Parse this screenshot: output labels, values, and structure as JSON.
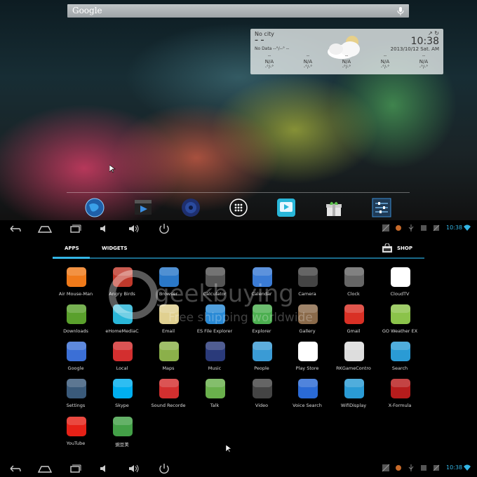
{
  "home": {
    "search": {
      "logo": "Google"
    },
    "weather": {
      "city": "No city",
      "dash": "– –",
      "nodata": "No Data --°/--° --",
      "time": "10:38",
      "date": "2013/10/12 Sat. AM",
      "columns": [
        {
          "top": "--",
          "value": "N/A",
          "bottom": "-°/-°"
        },
        {
          "top": "--",
          "value": "N/A",
          "bottom": "-°/-°"
        },
        {
          "top": "--",
          "value": "N/A",
          "bottom": "-°/-°"
        },
        {
          "top": "--",
          "value": "N/A",
          "bottom": "-°/-°"
        },
        {
          "top": "--",
          "value": "N/A",
          "bottom": "-°/-°"
        }
      ]
    },
    "dock": [
      "globe-icon",
      "video-player-icon",
      "speaker-icon",
      "all-apps-icon",
      "ehome-media-icon",
      "gift-box-icon",
      "settings-sliders-icon"
    ]
  },
  "statusbar": {
    "time": "10:38"
  },
  "drawer": {
    "tabs": {
      "apps": "APPS",
      "widgets": "WIDGETS",
      "shop": "SHOP"
    },
    "apps": [
      {
        "label": "Air Mouse-Man",
        "icon": "air-mouse-icon",
        "color": "#f07a1a"
      },
      {
        "label": "Angry Birds",
        "icon": "angry-birds-icon",
        "color": "#c0392b"
      },
      {
        "label": "Browser",
        "icon": "browser-globe-icon",
        "color": "#2a78c8"
      },
      {
        "label": "Calculator",
        "icon": "calculator-icon",
        "color": "#555555"
      },
      {
        "label": "Calendar",
        "icon": "calendar-icon",
        "color": "#3a7bd5"
      },
      {
        "label": "Camera",
        "icon": "camera-icon",
        "color": "#444444"
      },
      {
        "label": "Clock",
        "icon": "clock-icon",
        "color": "#666666"
      },
      {
        "label": "CloudTV",
        "icon": "cloudtv-icon",
        "color": "#ffffff"
      },
      {
        "label": "Downloads",
        "icon": "download-icon",
        "color": "#5aa02c"
      },
      {
        "label": "eHomeMediaC",
        "icon": "ehome-media-icon",
        "color": "#29b6d8"
      },
      {
        "label": "Email",
        "icon": "email-icon",
        "color": "#e0d090"
      },
      {
        "label": "ES File Explorer",
        "icon": "es-file-explorer-icon",
        "color": "#2a8ad5"
      },
      {
        "label": "Explorer",
        "icon": "explorer-icon",
        "color": "#4caf50"
      },
      {
        "label": "Gallery",
        "icon": "gallery-icon",
        "color": "#8a6a4a"
      },
      {
        "label": "Gmail",
        "icon": "gmail-icon",
        "color": "#d93025"
      },
      {
        "label": "GO Weather EX",
        "icon": "go-weather-icon",
        "color": "#8bc34a"
      },
      {
        "label": "Google",
        "icon": "google-search-icon",
        "color": "#3b6fd6"
      },
      {
        "label": "Local",
        "icon": "map-pin-icon",
        "color": "#d32f2f"
      },
      {
        "label": "Maps",
        "icon": "maps-icon",
        "color": "#8bb04a"
      },
      {
        "label": "Music",
        "icon": "music-speaker-icon",
        "color": "#2a3a7a"
      },
      {
        "label": "People",
        "icon": "people-icon",
        "color": "#3a9bd5"
      },
      {
        "label": "Play Store",
        "icon": "play-store-icon",
        "color": "#ffffff"
      },
      {
        "label": "RKGameContro",
        "icon": "gamepad-icon",
        "color": "#dddddd"
      },
      {
        "label": "Search",
        "icon": "search-icon",
        "color": "#2a9bd5"
      },
      {
        "label": "Settings",
        "icon": "settings-icon",
        "color": "#3a5a7a"
      },
      {
        "label": "Skype",
        "icon": "skype-icon",
        "color": "#00aff0"
      },
      {
        "label": "Sound Recorde",
        "icon": "microphone-record-icon",
        "color": "#d32f2f"
      },
      {
        "label": "Talk",
        "icon": "talk-icon",
        "color": "#6ab04c"
      },
      {
        "label": "Video",
        "icon": "video-clapper-icon",
        "color": "#444444"
      },
      {
        "label": "Voice Search",
        "icon": "voice-search-icon",
        "color": "#2a6ad5"
      },
      {
        "label": "WifiDisplay",
        "icon": "share-icon",
        "color": "#2a9bd5"
      },
      {
        "label": "X-Formula",
        "icon": "x-formula-icon",
        "color": "#b71c1c"
      },
      {
        "label": "YouTube",
        "icon": "youtube-icon",
        "color": "#e62117"
      },
      {
        "label": "豌豆荚",
        "icon": "wandoujia-icon",
        "color": "#43a047"
      }
    ]
  },
  "watermark": {
    "brand": "geekbuying",
    "tagline": "Free shipping worldwide"
  }
}
